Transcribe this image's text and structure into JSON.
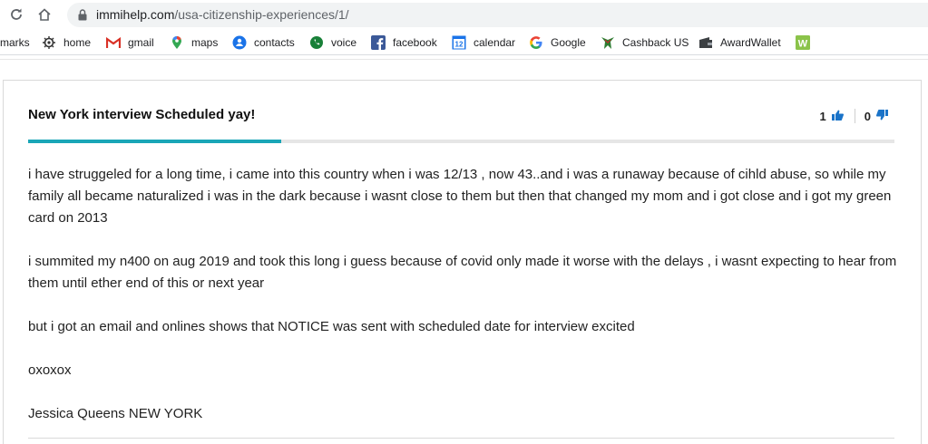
{
  "browser": {
    "url_host": "immihelp.com",
    "url_path": "/usa-citizenship-experiences/1/",
    "bookmarks": [
      {
        "label": "marks",
        "icon": "bookmarks-overflow"
      },
      {
        "label": "home",
        "icon": "home-icon"
      },
      {
        "label": "gmail",
        "icon": "gmail-icon"
      },
      {
        "label": "maps",
        "icon": "maps-icon"
      },
      {
        "label": "contacts",
        "icon": "contacts-icon"
      },
      {
        "label": "voice",
        "icon": "voice-icon"
      },
      {
        "label": "facebook",
        "icon": "facebook-icon"
      },
      {
        "label": "calendar",
        "icon": "calendar-icon"
      },
      {
        "label": "Google",
        "icon": "google-icon"
      },
      {
        "label": "Cashback US",
        "icon": "cashback-icon"
      },
      {
        "label": "AwardWallet",
        "icon": "awardwallet-icon"
      },
      {
        "label": "",
        "icon": "bookmark-w-icon"
      }
    ],
    "calendar_glyph": "12",
    "w_glyph": "W"
  },
  "post": {
    "title": "New York interview Scheduled yay!",
    "upvotes": "1",
    "downvotes": "0",
    "reading_progress": 0.292,
    "paragraphs": [
      "i have struggeled for a long time, i came into this country when i was 12/13 , now 43..and i was a runaway because of cihld abuse, so while my family all became naturalized i was in the dark because i wasnt close to them but then that changed my mom and i got close and i got my green card on 2013",
      "i summited my n400 on aug 2019 and took this long i guess because of covid only made it worse with the delays , i wasnt expecting to hear from them until ether end of this or next year",
      "but i got an email and onlines shows that NOTICE was sent with scheduled date for interview excited",
      "oxoxox",
      "Jessica Queens NEW YORK"
    ]
  },
  "colors": {
    "accent": "#1aa6b7",
    "vote_icon": "#1a73c8"
  }
}
